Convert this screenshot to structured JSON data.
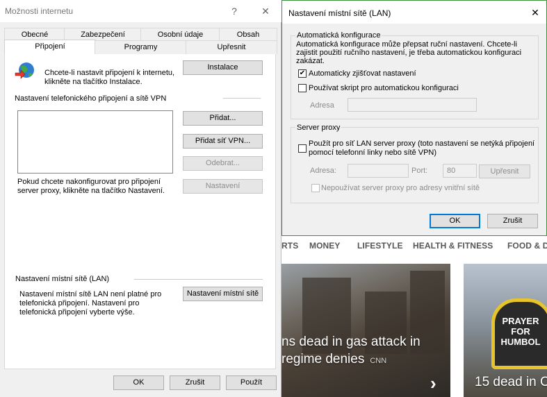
{
  "internet_options": {
    "title": "Možnosti internetu",
    "help_glyph": "?",
    "close_glyph": "✕",
    "tabs_row1": [
      "Obecné",
      "Zabezpečení",
      "Osobní údaje",
      "Obsah"
    ],
    "tabs_row2": [
      "Připojení",
      "Programy",
      "Upřesnit"
    ],
    "setup_text_line1": "Chcete-li nastavit připojení k internetu,",
    "setup_text_line2": "klikněte na tlačítko Instalace.",
    "setup_button": "Instalace",
    "dialup_section": "Nastavení telefonického připojení a sítě VPN",
    "add_button": "Přidat...",
    "add_vpn_button": "Přidat síť VPN...",
    "remove_button": "Odebrat...",
    "settings_button": "Nastavení",
    "proxy_hint_line1": "Pokud chcete nakonfigurovat pro připojení",
    "proxy_hint_line2": "server proxy, klikněte na tlačítko Nastavení.",
    "lan_section": "Nastavení místní sítě (LAN)",
    "lan_text_line1": "Nastavení místní sítě LAN není platné pro",
    "lan_text_line2": "telefonická připojení. Nastavení pro",
    "lan_text_line3": "telefonická připojení vyberte výše.",
    "lan_button": "Nastavení místní sítě",
    "ok": "OK",
    "cancel": "Zrušit",
    "apply": "Použít"
  },
  "lan_dialog": {
    "title": "Nastavení místní sítě (LAN)",
    "close_glyph": "✕",
    "auto_group": "Automatická konfigurace",
    "auto_desc_line1": "Automatická konfigurace může přepsat ruční nastavení. Chcete-li",
    "auto_desc_line2": "zajistit použití ručního nastavení, je třeba automatickou konfiguraci",
    "auto_desc_line3": "zakázat.",
    "auto_detect_label": "Automaticky zjišťovat nastavení",
    "auto_detect_checked": true,
    "use_script_label": "Používat skript pro automatickou konfiguraci",
    "use_script_checked": false,
    "address_label": "Adresa",
    "address_value": "",
    "proxy_group": "Server proxy",
    "use_proxy_line1": "Použít pro síť LAN server proxy (toto nastavení se netýká připojení",
    "use_proxy_line2": "pomocí telefonní linky nebo sítě VPN)",
    "use_proxy_checked": false,
    "proxy_address_label": "Adresa:",
    "proxy_address_value": "",
    "port_label": "Port:",
    "port_value": "80",
    "advanced_button": "Upřesnit",
    "bypass_label": "Nepoužívat server proxy pro adresy vnitřní sítě",
    "bypass_checked": false,
    "ok": "OK",
    "cancel": "Zrušit"
  },
  "background_news": {
    "nav_items": [
      "RTS",
      "MONEY",
      "LIFESTYLE",
      "HEALTH & FITNESS",
      "FOOD & D"
    ],
    "card1_line1": "ns dead in gas attack in",
    "card1_line2": "regime denies",
    "card1_source": "CNN",
    "card1_arrow": "›",
    "card2_headline": "15 dead in C",
    "card2_sign_line1": "PRAYER",
    "card2_sign_line2": "FOR",
    "card2_sign_line3": "HUMBOL"
  },
  "colors": {
    "dialog_bg": "#f0f0f0",
    "default_button_border": "#0078d7",
    "lan_window_border": "#3c8f3c"
  }
}
